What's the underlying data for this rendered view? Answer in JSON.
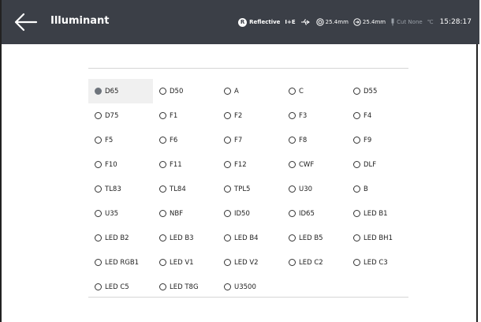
{
  "header": {
    "title": "Illuminant",
    "status": {
      "mode_icon_letter": "R",
      "mode": "Reflective",
      "spec": "I+E",
      "aperture_1": "25.4mm",
      "aperture_2": "25.4mm",
      "cut": "Cut None",
      "temp_unit": "℃",
      "time": "15:28:17"
    }
  },
  "illuminants": [
    {
      "label": "D65",
      "selected": true
    },
    {
      "label": "D50"
    },
    {
      "label": "A"
    },
    {
      "label": "C"
    },
    {
      "label": "D55"
    },
    {
      "label": "D75"
    },
    {
      "label": "F1"
    },
    {
      "label": "F2"
    },
    {
      "label": "F3"
    },
    {
      "label": "F4"
    },
    {
      "label": "F5"
    },
    {
      "label": "F6"
    },
    {
      "label": "F7"
    },
    {
      "label": "F8"
    },
    {
      "label": "F9"
    },
    {
      "label": "F10"
    },
    {
      "label": "F11"
    },
    {
      "label": "F12"
    },
    {
      "label": "CWF"
    },
    {
      "label": "DLF"
    },
    {
      "label": "TL83"
    },
    {
      "label": "TL84"
    },
    {
      "label": "TPL5"
    },
    {
      "label": "U30"
    },
    {
      "label": "B"
    },
    {
      "label": "U35"
    },
    {
      "label": "NBF"
    },
    {
      "label": "ID50"
    },
    {
      "label": "ID65"
    },
    {
      "label": "LED B1"
    },
    {
      "label": "LED B2"
    },
    {
      "label": "LED B3"
    },
    {
      "label": "LED B4"
    },
    {
      "label": "LED B5"
    },
    {
      "label": "LED BH1"
    },
    {
      "label": "LED RGB1"
    },
    {
      "label": "LED V1"
    },
    {
      "label": "LED V2"
    },
    {
      "label": "LED C2"
    },
    {
      "label": "LED C3"
    },
    {
      "label": "LED C5"
    },
    {
      "label": "LED T8G"
    },
    {
      "label": "U3500"
    }
  ]
}
